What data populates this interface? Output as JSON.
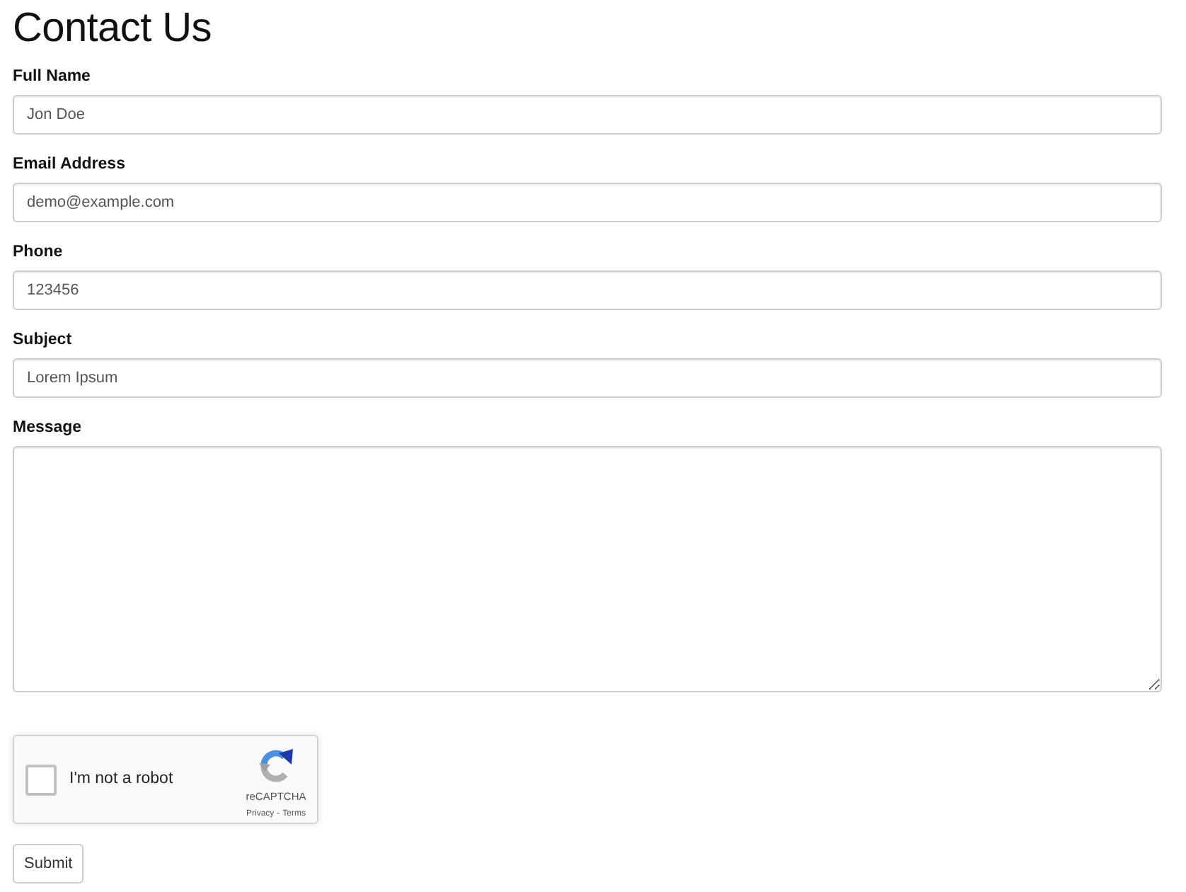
{
  "title": "Contact Us",
  "fields": [
    {
      "kind": "input",
      "label": "Full Name",
      "value": "Jon Doe"
    },
    {
      "kind": "input",
      "label": "Email Address",
      "value": "demo@example.com"
    },
    {
      "kind": "input",
      "label": "Phone",
      "value": "123456"
    },
    {
      "kind": "input",
      "label": "Subject",
      "value": "Lorem Ipsum"
    },
    {
      "kind": "textarea",
      "label": "Message"
    }
  ],
  "captcha": {
    "label": "I'm not a robot",
    "checked": false,
    "brand": "reCAPTCHA",
    "links": [
      "Privacy",
      "Terms"
    ],
    "separator": "-"
  },
  "submit": "Submit"
}
